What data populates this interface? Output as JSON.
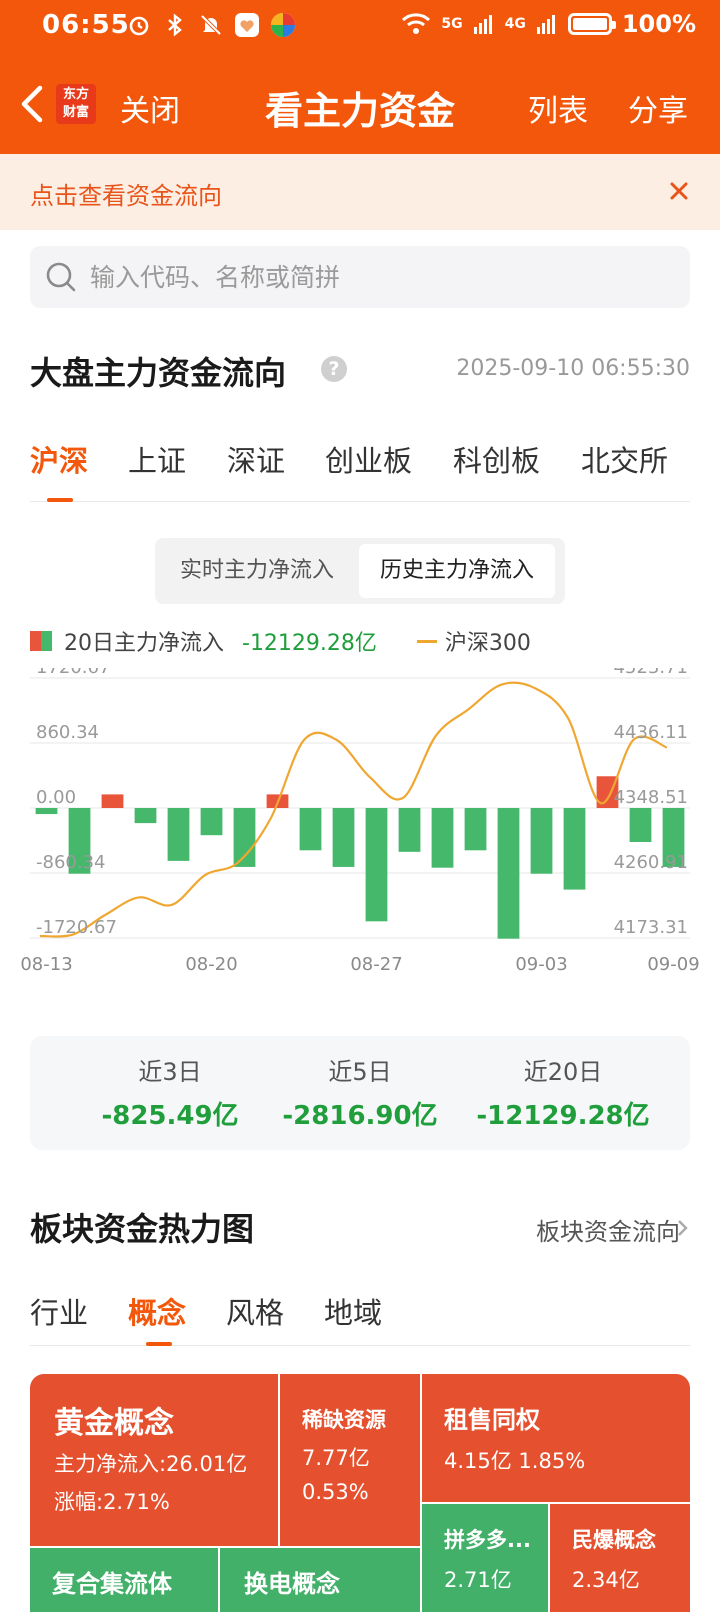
{
  "status": {
    "time": "06:55",
    "battery": "100%",
    "net1": "5G",
    "net2": "4G"
  },
  "header": {
    "logo_line1": "东方",
    "logo_line2": "财富",
    "close": "关闭",
    "title": "看主力资金",
    "list": "列表",
    "share": "分享"
  },
  "banner": {
    "text": "点击查看资金流向"
  },
  "search": {
    "placeholder": "输入代码、名称或简拼",
    "value": ""
  },
  "market": {
    "title": "大盘主力资金流向",
    "help": "?",
    "timestamp": "2025-09-10 06:55:30",
    "tabs": [
      "沪深",
      "上证",
      "深证",
      "创业板",
      "科创板",
      "北交所"
    ],
    "active_tab": 0,
    "toggle": [
      "实时主力净流入",
      "历史主力净流入"
    ],
    "toggle_selected": 1,
    "legend_flow": "20日主力净流入",
    "legend_flow_value": "-12129.28亿",
    "legend_index": "沪深300"
  },
  "chart_data": {
    "type": "bar",
    "series": [
      {
        "name": "20日主力净流入",
        "type": "bar",
        "values": [
          -80,
          -870,
          180,
          -200,
          -700,
          -360,
          -780,
          180,
          -560,
          -780,
          -1500,
          -580,
          -790,
          -560,
          -1730,
          -870,
          -1080,
          420,
          -450,
          -780
        ]
      },
      {
        "name": "沪深300",
        "type": "line",
        "values": [
          4176,
          4178,
          4205,
          4228,
          4218,
          4258,
          4275,
          4335,
          4440,
          4440,
          4390,
          4362,
          4446,
          4482,
          4515,
          4510,
          4470,
          4355,
          4441,
          4430
        ]
      }
    ],
    "tick_labels": [
      "08-13",
      "08-20",
      "08-27",
      "09-03",
      "09-09"
    ],
    "tick_indices": [
      0,
      5,
      10,
      15,
      19
    ],
    "y_left": [
      1720.67,
      860.34,
      0.0,
      -860.34,
      -1720.67
    ],
    "y_left_labels": [
      "1720.67",
      "860.34",
      "0.00",
      "-860.34",
      "-1720.67"
    ],
    "y_right": [
      4523.71,
      4436.11,
      4348.51,
      4260.91,
      4173.31
    ],
    "y_right_labels": [
      "4523.71",
      "4436.11",
      "4348.51",
      "4260.91",
      "4173.31"
    ],
    "ylim_left": [
      -1720.67,
      1720.67
    ],
    "ylim_right": [
      4173.31,
      4523.71
    ],
    "colors": {
      "inflow": "#e8553b",
      "outflow": "#45b86b",
      "line": "#f0a732",
      "grid": "#ececec"
    },
    "grid": true
  },
  "summary": [
    {
      "label": "近3日",
      "value": "-825.49亿"
    },
    {
      "label": "近5日",
      "value": "-2816.90亿"
    },
    {
      "label": "近20日",
      "value": "-12129.28亿"
    }
  ],
  "heatmap": {
    "title": "板块资金热力图",
    "link": "板块资金流向",
    "tabs": [
      "行业",
      "概念",
      "风格",
      "地域"
    ],
    "active_tab": 1,
    "tiles": [
      {
        "name": "黄金概念",
        "line1": "主力净流入:26.01亿",
        "line2": "涨幅:2.71%",
        "color": "#e5512f"
      },
      {
        "name": "稀缺资源",
        "line1": "7.77亿",
        "line2": "0.53%",
        "color": "#e5512f"
      },
      {
        "name": "租售同权",
        "line1": "4.15亿  1.85%",
        "color": "#e5512f"
      },
      {
        "name": "拼多多...",
        "line1": "2.71亿",
        "color": "#43b06a"
      },
      {
        "name": "民爆概念",
        "line1": "2.34亿",
        "color": "#e5512f"
      },
      {
        "name": "复合集流体",
        "color": "#43b06a"
      },
      {
        "name": "换电概念",
        "color": "#43b06a"
      }
    ]
  },
  "colors": {
    "brand": "#f2570b",
    "up": "#e5512f",
    "down": "#1f9e3b"
  }
}
